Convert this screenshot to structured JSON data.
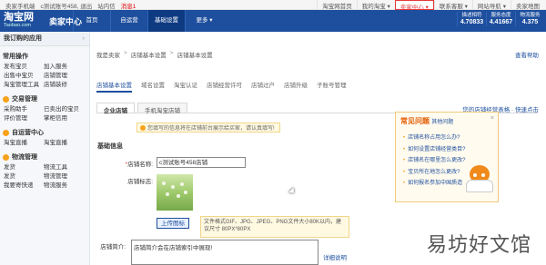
{
  "topbar": {
    "left": [
      "卖家手机端",
      "c测试账号458, 退出",
      "站内信",
      "消息1"
    ],
    "right": [
      "淘宝网首页",
      "我的淘宝 ▾",
      "卖家中心 ▾",
      "联系客服 ▾",
      "网站导航 ▾",
      "卖家地图"
    ],
    "active_index": 2
  },
  "header": {
    "logo_cn": "淘宝网",
    "logo_en": "Taobao.com",
    "section": "卖家中心",
    "nav": [
      "首页",
      "自运营",
      "基础设置",
      "更多 ▾"
    ],
    "nav_active": 2,
    "ratings": [
      {
        "label": "描述相符",
        "value": "4.70833"
      },
      {
        "label": "服务态度",
        "value": "4.41667"
      },
      {
        "label": "物流服务",
        "value": "4.375"
      }
    ]
  },
  "sidebar": {
    "my_apps": "我订购的应用",
    "sections": [
      {
        "title": "常用操作",
        "items": [
          "发布宝贝",
          "加入服务",
          "出售中宝贝",
          "店铺管理",
          "淘宝管理工具",
          "店铺装修"
        ]
      },
      {
        "title": "交易管理",
        "items": [
          "采购助手",
          "已卖出的宝贝",
          "评价管理",
          "掌柜信用"
        ]
      },
      {
        "title": "自运营中心",
        "items": [
          "淘宝直播",
          "淘宝直播"
        ]
      },
      {
        "title": "物流管理",
        "items": [
          "发货",
          "物流工具",
          "发货",
          "物流管理",
          "我要寄快递",
          "物流服务"
        ]
      }
    ]
  },
  "breadcrumb": [
    "我是卖家",
    "店铺基本设置",
    "店铺基本设置"
  ],
  "help_link": "查看帮助",
  "main_tabs": [
    "店铺基本设置",
    "域名设置",
    "淘宝认证",
    "店铺经营许可",
    "店铺过户",
    "店铺升级",
    "子账号管理"
  ],
  "subtabs": [
    "企业店铺",
    "手机淘宝店铺"
  ],
  "subtab_right": "您的店铺经营表格 · 快速点击",
  "notice": "您填写的信息将在店铺前台展示给买家，请认真填写!",
  "basic_info_title": "基础信息",
  "form": {
    "name_label": "店铺名称:",
    "name_value": "c测试账号458店铺",
    "logo_label": "店铺标志:",
    "upload_button": "上传图标",
    "upload_tip": "文件格式GIF、JPG、JPEG、PNG文件大小80K以内，建议尺寸 80PX*80PX",
    "desc_label": "店铺简介:",
    "desc_value": "店铺简介会在店铺索引中展现!",
    "desc_link": "详细说明"
  },
  "faq": {
    "title": "常见问题",
    "title_small": "其他问题",
    "close": "×",
    "items": [
      "店铺名称占用怎么办?",
      "如何设置店铺经营类目?",
      "店铺名在哪里怎么更改?",
      "宝贝所在地怎么更改?",
      "如何报名参加中国质造"
    ]
  },
  "watermark": "易坊好文馆"
}
